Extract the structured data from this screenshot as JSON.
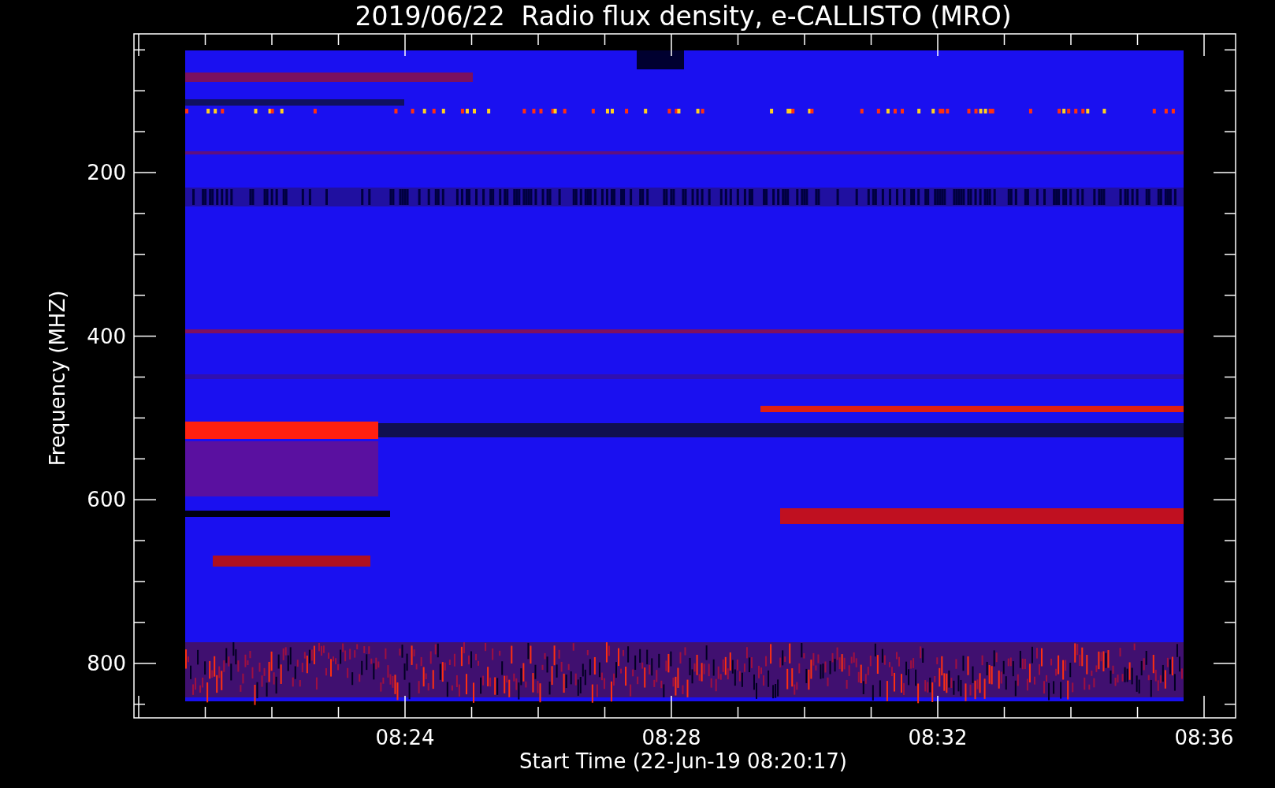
{
  "title": "2019/06/22  Radio flux density, e-CALLISTO (MRO)",
  "plot": {
    "ylabel": "Frequency (MHZ)",
    "xlabel": "Start Time (22-Jun-19 08:20:17)",
    "yticks": [
      "200",
      "400",
      "600",
      "800"
    ],
    "xticks": [
      "08:24",
      "08:28",
      "08:32",
      "08:36"
    ]
  }
}
